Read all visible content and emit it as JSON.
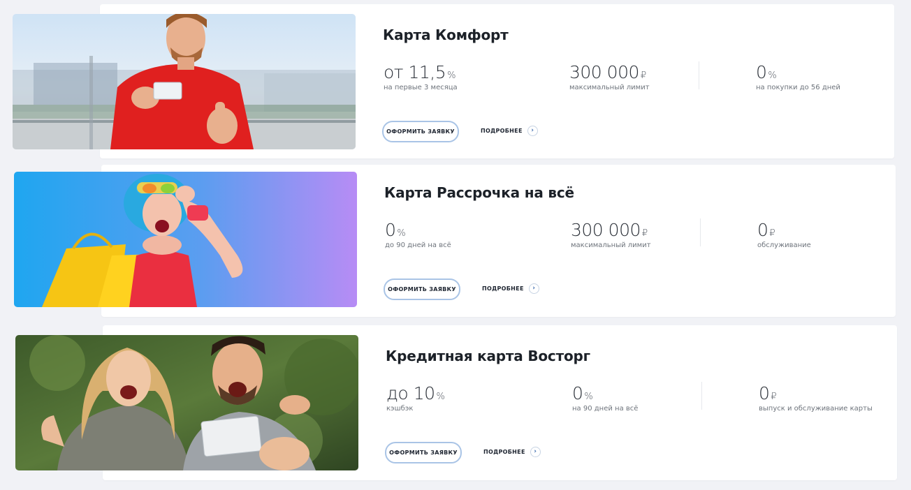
{
  "cards": [
    {
      "title": "Карта Комфорт",
      "stats": [
        {
          "prefix": "от ",
          "value": "11,5",
          "unit": "%",
          "caption": "на первые 3 месяца"
        },
        {
          "prefix": "",
          "value": "300 000",
          "unit": "₽",
          "caption": "максимальный лимит"
        },
        {
          "prefix": "",
          "value": "0",
          "unit": "%",
          "caption": "на покупки до 56 дней"
        }
      ],
      "apply_label": "ОФОРМИТЬ ЗАЯВКУ",
      "more_label": "ПОДРОБНЕЕ",
      "image_subject": "man-in-red-shirt-with-card-photo"
    },
    {
      "title": "Карта Рассрочка на всё",
      "stats": [
        {
          "prefix": "",
          "value": "0",
          "unit": "%",
          "caption": "до 90 дней на всё"
        },
        {
          "prefix": "",
          "value": "300 000",
          "unit": "₽",
          "caption": "максимальный лимит"
        },
        {
          "prefix": "",
          "value": "0",
          "unit": "₽",
          "caption": "обслуживание"
        }
      ],
      "apply_label": "ОФОРМИТЬ ЗАЯВКУ",
      "more_label": "ПОДРОБНЕЕ",
      "image_subject": "woman-with-shopping-bags-photo"
    },
    {
      "title": "Кредитная карта Восторг",
      "stats": [
        {
          "prefix": "до ",
          "value": "10",
          "unit": "%",
          "caption": "кэшбэк"
        },
        {
          "prefix": "",
          "value": "0",
          "unit": "%",
          "caption": "на 90 дней на всё"
        },
        {
          "prefix": "",
          "value": "0",
          "unit": "₽",
          "caption": "выпуск и обслуживание карты"
        }
      ],
      "apply_label": "ОФОРМИТЬ ЗАЯВКУ",
      "more_label": "ПОДРОБНЕЕ",
      "image_subject": "excited-couple-with-card-photo"
    }
  ],
  "colors": {
    "background": "#f1f2f6",
    "button_border": "#a9c4e6",
    "text_dark": "#1c2128",
    "chevron": "#2d5fa8"
  }
}
